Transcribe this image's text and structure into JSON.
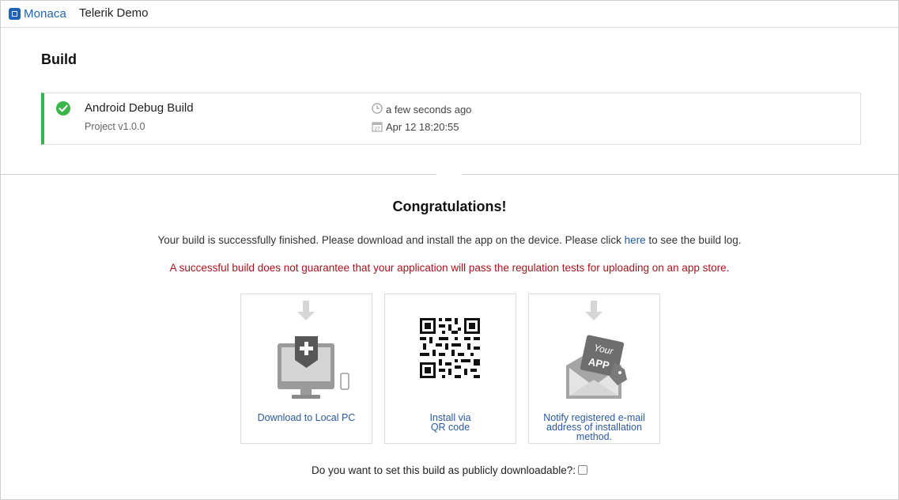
{
  "header": {
    "brand": "Monaca",
    "project": "Telerik Demo"
  },
  "build": {
    "section_title": "Build",
    "name": "Android Debug Build",
    "version": "Project v1.0.0",
    "time_ago": "a few seconds ago",
    "date": "Apr 12 18:20:55",
    "status_color": "#34b54a"
  },
  "result": {
    "title": "Congratulations!",
    "message_before": "Your build is successfully finished. Please download and install the app on the device. Please click ",
    "message_link": "here",
    "message_after": " to see the build log.",
    "warning": "A successful build does not guarantee that your application will pass the regulation tests for uploading on an app store."
  },
  "options": [
    {
      "label_lines": [
        "Download to Local PC"
      ],
      "icon": "download-pc-icon"
    },
    {
      "label_lines": [
        "Install via",
        "QR code"
      ],
      "icon": "qr-code-icon"
    },
    {
      "label_lines": [
        "Notify registered e-mail",
        "address of installation",
        "method."
      ],
      "icon": "email-app-icon"
    }
  ],
  "public_download": {
    "question": "Do you want to set this build as publicly downloadable?:",
    "checked": false
  },
  "colors": {
    "brand": "#1f63b7",
    "link": "#2a5aa0",
    "warning": "#a3141c",
    "success": "#39b54a"
  }
}
